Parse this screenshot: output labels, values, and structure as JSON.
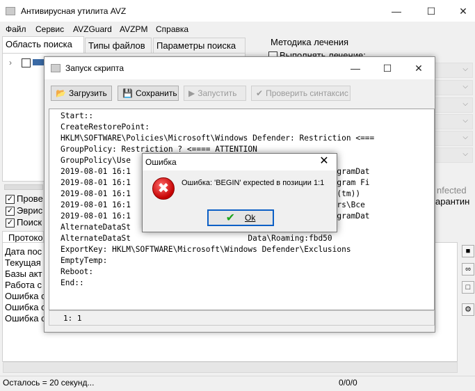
{
  "main": {
    "title": "Антивирусная утилита AVZ",
    "menu": [
      "Файл",
      "Сервис",
      "AVZGuard",
      "AVZPM",
      "Справка"
    ],
    "tabs": [
      "Область поиска",
      "Типы файлов",
      "Параметры поиска"
    ],
    "method_title": "Методика лечения",
    "perform_treatment": "Выполнять лечение:",
    "infected_label": "nfected",
    "quarantine_label": "арантин",
    "checks": [
      "Прове",
      "Эврис",
      "Поиск"
    ],
    "log_tab": "Протоко",
    "log_lines": [
      "Дата пос",
      "Текущая",
      "Базы акт",
      "Работа с",
      "Ошибка с",
      "Ошибка с",
      "Ошибка с"
    ],
    "status_left": "Осталось = 20 секунд...",
    "status_mid": "0/0/0"
  },
  "script_window": {
    "title": "Запуск скрипта",
    "toolbar": {
      "load": "Загрузить",
      "save": "Сохранить",
      "run": "Запустить",
      "check_syntax": "Проверить синтаксис"
    },
    "lines": [
      "Start::",
      "CreateRestorePoint:",
      "HKLM\\SOFTWARE\\Policies\\Microsoft\\Windows Defender: Restriction <===",
      "GroupPolicy: Restriction ? <==== ATTENTION",
      "GroupPolicy\\Use",
      "2019-08-01 16:1                                    D C:\\ProgramDat",
      "2019-08-01 16:1                                    D C:\\Program Fi",
      "2019-08-01 16:1                                     (REALiX(tm))",
      "2019-08-01 16:1                                    D C:\\Users\\Все",
      "2019-08-01 16:1                                    D C:\\ProgramDat",
      "AlternateDataSt                         ication Data:fbd5",
      "AlternateDataSt                         Data\\Roaming:fbd50",
      "ExportKey: HKLM\\SOFTWARE\\Microsoft\\Windows Defender\\Exclusions",
      "EmptyTemp:",
      "Reboot:",
      "End::"
    ],
    "cursor": "1: 1"
  },
  "error_dialog": {
    "title": "Ошибка",
    "message": "Ошибка: 'BEGIN' expected в позиции 1:1",
    "ok": "Ok"
  }
}
